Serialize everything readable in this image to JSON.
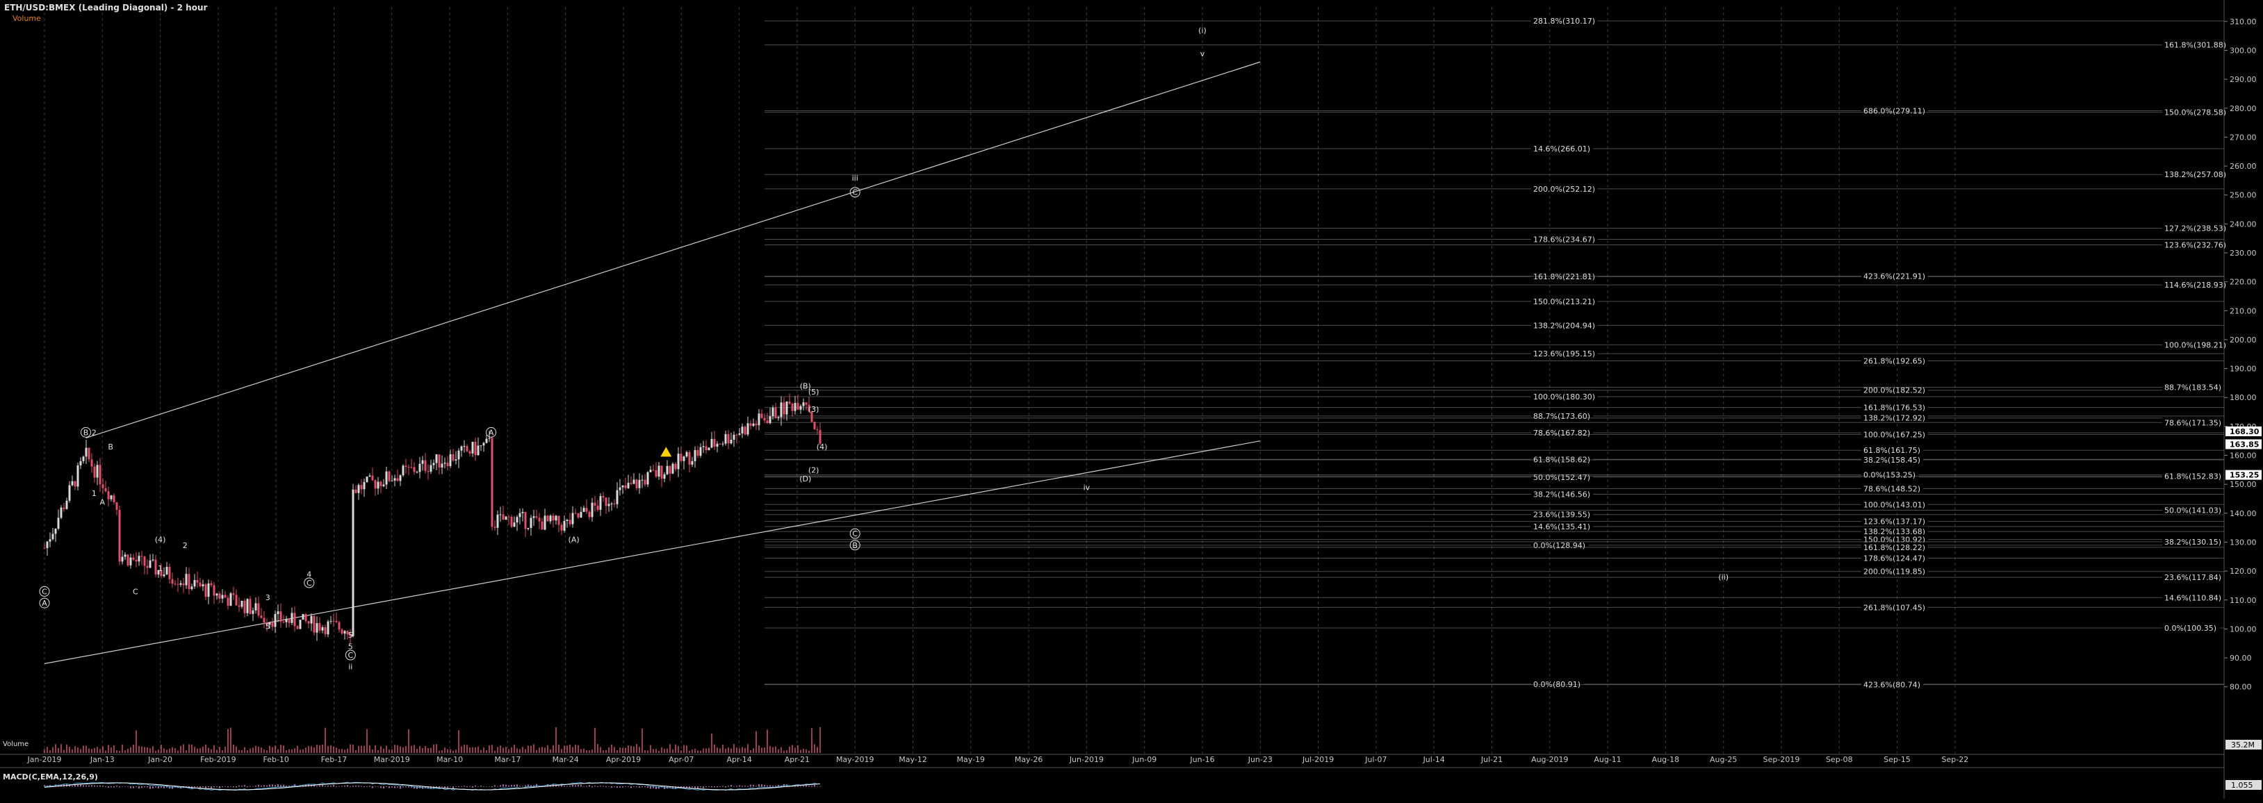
{
  "header": {
    "title": "ETH/USD:BMEX (Leading Diagonal) - 2 hour",
    "subtitle": "Volume"
  },
  "indicator": {
    "volume_label": "Volume",
    "macd_label": "MACD(C,EMA,12,26,9)",
    "volume_value": "35.2M",
    "macd_value": "1.055"
  },
  "colors": {
    "background": "#000000",
    "grid": "#3a3a3a",
    "axis_text": "#c8c8c8",
    "up_candle": "#d9d9d9",
    "down_candle": "#e0506a",
    "volume_bar": "#c0506a",
    "macd_line": "#4aa3d0",
    "signal_line": "#ffffff",
    "fib_line": "#8a8a8a",
    "price_tag": "#ffffff",
    "warning": "#ffd000",
    "red_label": "#e04040",
    "title": "#e0e0e0",
    "subtitle": "#e08020"
  },
  "chart_data": {
    "type": "candlestick",
    "title": "ETH/USD:BMEX (Leading Diagonal) - 2 hour",
    "ylim": [
      60,
      315
    ],
    "y_ticks": [
      "310.00",
      "300.00",
      "290.00",
      "280.00",
      "270.00",
      "260.00",
      "250.00",
      "240.00",
      "230.00",
      "220.00",
      "210.00",
      "200.00",
      "190.00",
      "180.00",
      "170.00",
      "160.00",
      "150.00",
      "140.00",
      "130.00",
      "120.00",
      "110.00",
      "100.00",
      "90.00",
      "80.00"
    ],
    "x_ticks": [
      "Jan-2019",
      "Jan-13",
      "Jan-20",
      "Feb-2019",
      "Feb-10",
      "Feb-17",
      "Mar-2019",
      "Mar-10",
      "Mar-17",
      "Mar-24",
      "Apr-2019",
      "Apr-07",
      "Apr-14",
      "Apr-21",
      "May-2019",
      "May-12",
      "May-19",
      "May-26",
      "Jun-2019",
      "Jun-09",
      "Jun-16",
      "Jun-23",
      "Jul-2019",
      "Jul-07",
      "Jul-14",
      "Jul-21",
      "Aug-2019",
      "Aug-11",
      "Aug-18",
      "Aug-25",
      "Sep-2019",
      "Sep-08",
      "Sep-15",
      "Sep-22"
    ],
    "price_anchors": [
      {
        "date": "Jan-2019",
        "price": 128
      },
      {
        "date": "Jan-06",
        "price": 160
      },
      {
        "date": "Jan-10",
        "price": 142
      },
      {
        "date": "Jan-13",
        "price": 128
      },
      {
        "date": "Jan-20",
        "price": 120
      },
      {
        "date": "Jan-27",
        "price": 106
      },
      {
        "date": "Feb-2019",
        "price": 106
      },
      {
        "date": "Feb-07",
        "price": 100
      },
      {
        "date": "Feb-10",
        "price": 118
      },
      {
        "date": "Feb-17",
        "price": 146
      },
      {
        "date": "Feb-24",
        "price": 164
      },
      {
        "date": "Mar-2019",
        "price": 136
      },
      {
        "date": "Mar-10",
        "price": 134
      },
      {
        "date": "Mar-17",
        "price": 138
      },
      {
        "date": "Mar-24",
        "price": 136
      },
      {
        "date": "Apr-2019",
        "price": 148
      },
      {
        "date": "Apr-03",
        "price": 180
      },
      {
        "date": "Apr-05",
        "price": 162
      }
    ],
    "last_price_tags": [
      "168.30",
      "163.85",
      "153.25"
    ],
    "fib_labels_col1": [
      {
        "text": "281.8%(310.17)",
        "price": 310.17
      },
      {
        "text": "14.6%(266.01)",
        "price": 266.01
      },
      {
        "text": "200.0%(252.12)",
        "price": 252.12
      },
      {
        "text": "178.6%(234.67)",
        "price": 234.67
      },
      {
        "text": "161.8%(221.81)",
        "price": 221.81
      },
      {
        "text": "150.0%(213.21)",
        "price": 213.21
      },
      {
        "text": "138.2%(204.94)",
        "price": 204.94
      },
      {
        "text": "123.6%(195.15)",
        "price": 195.15
      },
      {
        "text": "100.0%(180.30)",
        "price": 180.3
      },
      {
        "text": "88.7%(173.60)",
        "price": 173.6
      },
      {
        "text": "78.6%(167.82)",
        "price": 167.82
      },
      {
        "text": "61.8%(158.62)",
        "price": 158.62
      },
      {
        "text": "50.0%(152.47)",
        "price": 152.47
      },
      {
        "text": "38.2%(146.56)",
        "price": 146.56
      },
      {
        "text": "23.6%(139.55)",
        "price": 139.55
      },
      {
        "text": "14.6%(135.41)",
        "price": 135.41
      },
      {
        "text": "0.0%(128.94)",
        "price": 128.94
      },
      {
        "text": "0.0%(80.91)",
        "price": 80.91
      }
    ],
    "fib_labels_col2": [
      {
        "text": "686.0%(279.11)",
        "price": 279.11
      },
      {
        "text": "423.6%(221.91)",
        "price": 221.91
      },
      {
        "text": "261.8%(192.65)",
        "price": 192.65
      },
      {
        "text": "200.0%(182.52)",
        "price": 182.52
      },
      {
        "text": "161.8%(176.53)",
        "price": 176.53
      },
      {
        "text": "138.2%(172.92)",
        "price": 172.92
      },
      {
        "text": "100.0%(167.25)",
        "price": 167.25
      },
      {
        "text": "61.8%(161.75)",
        "price": 161.75
      },
      {
        "text": "38.2%(158.45)",
        "price": 158.45
      },
      {
        "text": "0.0%(153.25)",
        "price": 153.25
      },
      {
        "text": "78.6%(148.52)",
        "price": 148.52
      },
      {
        "text": "100.0%(143.01)",
        "price": 143.01
      },
      {
        "text": "123.6%(137.17)",
        "price": 137.17
      },
      {
        "text": "138.2%(133.68)",
        "price": 133.68
      },
      {
        "text": "150.0%(130.92)",
        "price": 130.92
      },
      {
        "text": "161.8%(128.22)",
        "price": 128.22
      },
      {
        "text": "178.6%(124.47)",
        "price": 124.47
      },
      {
        "text": "200.0%(119.85)",
        "price": 119.85
      },
      {
        "text": "261.8%(107.45)",
        "price": 107.45
      },
      {
        "text": "423.6%(80.74)",
        "price": 80.74
      }
    ],
    "fib_labels_right": [
      {
        "text": "161.8%(301.88)",
        "price": 301.88
      },
      {
        "text": "150.0%(278.58)",
        "price": 278.58
      },
      {
        "text": "138.2%(257.08)",
        "price": 257.08
      },
      {
        "text": "127.2%(238.53)",
        "price": 238.53
      },
      {
        "text": "123.6%(232.76)",
        "price": 232.76
      },
      {
        "text": "114.6%(218.93)",
        "price": 218.93
      },
      {
        "text": "100.0%(198.21)",
        "price": 198.21
      },
      {
        "text": "88.7%(183.54)",
        "price": 183.54
      },
      {
        "text": "78.6%(171.35)",
        "price": 171.35
      },
      {
        "text": "61.8%(152.83)",
        "price": 152.83
      },
      {
        "text": "50.0%(141.03)",
        "price": 141.03
      },
      {
        "text": "38.2%(130.15)",
        "price": 130.15
      },
      {
        "text": "23.6%(117.84)",
        "price": 117.84
      },
      {
        "text": "14.6%(110.84)",
        "price": 110.84
      },
      {
        "text": "0.0%(100.35)",
        "price": 100.35
      }
    ],
    "wave_labels": [
      {
        "text": "C",
        "date": "Jan-2019",
        "price": 112,
        "circle": true
      },
      {
        "text": "A",
        "date": "Jan-2019",
        "price": 108,
        "circle": true
      },
      {
        "text": "B",
        "date": "Jan-06",
        "price": 167,
        "circle": true
      },
      {
        "text": "2",
        "date": "Jan-07",
        "price": 167,
        "circle": false
      },
      {
        "text": "B",
        "date": "Jan-09",
        "price": 162,
        "circle": false
      },
      {
        "text": "1",
        "date": "Jan-07",
        "price": 146,
        "circle": false
      },
      {
        "text": "A",
        "date": "Jan-08",
        "price": 143,
        "circle": false
      },
      {
        "text": "(4)",
        "date": "Jan-15",
        "price": 130,
        "circle": false
      },
      {
        "text": "2",
        "date": "Jan-18",
        "price": 128,
        "circle": false
      },
      {
        "text": "1",
        "date": "Jan-15",
        "price": 120,
        "circle": false
      },
      {
        "text": "C",
        "date": "Jan-12",
        "price": 112,
        "circle": false
      },
      {
        "text": "3",
        "date": "Jan-28",
        "price": 110,
        "circle": false
      },
      {
        "text": "5",
        "date": "Jan-28",
        "price": 100,
        "circle": false
      },
      {
        "text": "4",
        "date": "Feb-02",
        "price": 118,
        "circle": false
      },
      {
        "text": "C",
        "date": "Feb-02",
        "price": 115,
        "circle": true
      },
      {
        "text": "5",
        "date": "Feb-07",
        "price": 97,
        "circle": false
      },
      {
        "text": "5",
        "date": "Feb-07",
        "price": 93,
        "circle": false
      },
      {
        "text": "C",
        "date": "Feb-07",
        "price": 90,
        "circle": true
      },
      {
        "text": "ii",
        "date": "Feb-07",
        "price": 86,
        "circle": false
      },
      {
        "text": "A",
        "date": "Feb-24",
        "price": 167,
        "circle": true
      },
      {
        "text": "(A)",
        "date": "Mar-06",
        "price": 130,
        "circle": false
      },
      {
        "text": "(B)",
        "date": "Apr-03",
        "price": 183,
        "circle": false
      },
      {
        "text": "(5)",
        "date": "Apr-04",
        "price": 181,
        "circle": false
      },
      {
        "text": "(3)",
        "date": "Apr-04",
        "price": 175,
        "circle": false
      },
      {
        "text": "(4)",
        "date": "Apr-05",
        "price": 162,
        "circle": false
      },
      {
        "text": "(2)",
        "date": "Apr-04",
        "price": 154,
        "circle": false
      },
      {
        "text": "(D)",
        "date": "Apr-03",
        "price": 151,
        "circle": false
      },
      {
        "text": "C",
        "date": "Apr-09",
        "price": 132,
        "circle": true
      },
      {
        "text": "B",
        "date": "Apr-09",
        "price": 128,
        "circle": true
      },
      {
        "text": "iii",
        "date": "May-2019",
        "price": 255,
        "circle": false
      },
      {
        "text": "C",
        "date": "May-2019",
        "price": 250,
        "circle": true
      },
      {
        "text": "(i)",
        "date": "Jun-16",
        "price": 306,
        "circle": false
      },
      {
        "text": "v",
        "date": "Jun-16",
        "price": 298,
        "circle": false
      },
      {
        "text": "iv",
        "date": "Jun-2019",
        "price": 148,
        "circle": false
      },
      {
        "text": "(ii)",
        "date": "Aug-25",
        "price": 117,
        "circle": false
      }
    ],
    "trendlines": [
      {
        "from": {
          "date": "Jan-2019",
          "price": 88
        },
        "to": {
          "date": "Jun-23",
          "price": 165
        }
      },
      {
        "from": {
          "date": "Jan-06",
          "price": 166
        },
        "to": {
          "date": "Jun-23",
          "price": 296
        }
      }
    ]
  }
}
